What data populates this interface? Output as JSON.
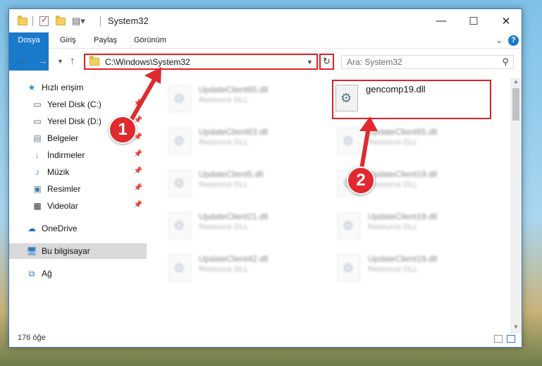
{
  "window": {
    "title": "System32"
  },
  "ribbon": {
    "tabs": [
      "Dosya",
      "Giriş",
      "Paylaş",
      "Görünüm"
    ],
    "help": "?"
  },
  "nav": {
    "back_icon": "back-arrow-icon",
    "forward_icon": "forward-arrow-icon",
    "recent_icon": "chevron-down-icon",
    "up_icon": "up-arrow-icon",
    "address": "C:\\Windows\\System32",
    "search_placeholder": "Ara: System32"
  },
  "sidebar": {
    "items": [
      {
        "label": "Hızlı erişim",
        "icon": "star-icon"
      },
      {
        "label": "Yerel Disk (C:)",
        "icon": "drive-icon",
        "pinned": true
      },
      {
        "label": "Yerel Disk (D:)",
        "icon": "drive-icon",
        "pinned": true
      },
      {
        "label": "Belgeler",
        "icon": "documents-icon",
        "pinned": true
      },
      {
        "label": "İndirmeler",
        "icon": "download-icon",
        "pinned": true
      },
      {
        "label": "Müzik",
        "icon": "music-icon",
        "pinned": true
      },
      {
        "label": "Resimler",
        "icon": "pictures-icon",
        "pinned": true
      },
      {
        "label": "Videolar",
        "icon": "video-icon",
        "pinned": true
      },
      {
        "label": "OneDrive",
        "icon": "cloud-icon"
      },
      {
        "label": "Bu bilgisayar",
        "icon": "computer-icon",
        "selected": true
      },
      {
        "label": "Ağ",
        "icon": "network-icon"
      }
    ]
  },
  "files": {
    "highlighted": {
      "name": "gencomp19.dll"
    },
    "left": [
      {
        "name": "UpdateClient65.dll",
        "type": "Resource DLL"
      },
      {
        "name": "UpdateClient63.dll",
        "type": "Resource DLL"
      },
      {
        "name": "UpdateClient5.dll",
        "type": "Resource DLL"
      },
      {
        "name": "UpdateClient21.dll",
        "type": "Resource DLL"
      },
      {
        "name": "UpdateClient42.dll",
        "type": "Resource DLL"
      }
    ],
    "right": [
      {
        "name": "UpdateClient65.dll",
        "type": "Resource DLL"
      },
      {
        "name": "UpdateClient19.dll",
        "type": "Resource DLL"
      },
      {
        "name": "UpdateClient19.dll",
        "type": "Resource DLL"
      },
      {
        "name": "UpdateClient19.dll",
        "type": "Resource DLL"
      }
    ]
  },
  "status": {
    "count": "176 öğe"
  },
  "annotations": {
    "step1": "1",
    "step2": "2"
  },
  "colors": {
    "accent": "#1979ca",
    "highlight": "#e01f26"
  }
}
